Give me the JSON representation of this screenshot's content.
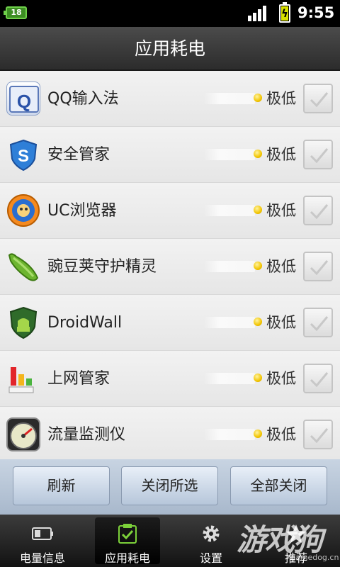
{
  "status_bar": {
    "battery_small": "18",
    "time": "9:55",
    "signal_icon": "signal-bars-icon",
    "charging_icon": "battery-charging-icon"
  },
  "title": "应用耗电",
  "apps": [
    {
      "name": "QQ输入法",
      "usage": "极低",
      "checked": true,
      "icon": "qq-input-icon"
    },
    {
      "name": "安全管家",
      "usage": "极低",
      "checked": true,
      "icon": "security-shield-icon"
    },
    {
      "name": "UC浏览器",
      "usage": "极低",
      "checked": true,
      "icon": "uc-browser-icon"
    },
    {
      "name": "豌豆荚守护精灵",
      "usage": "极低",
      "checked": true,
      "icon": "pea-pod-icon"
    },
    {
      "name": "DroidWall",
      "usage": "极低",
      "checked": true,
      "icon": "droidwall-shield-icon"
    },
    {
      "name": "上网管家",
      "usage": "极低",
      "checked": true,
      "icon": "network-bars-icon"
    },
    {
      "name": "流量监测仪",
      "usage": "极低",
      "checked": true,
      "icon": "speedometer-icon"
    }
  ],
  "buttons": {
    "refresh": "刷新",
    "close_selected": "关闭所选",
    "close_all": "全部关闭"
  },
  "tabs": [
    {
      "label": "电量信息",
      "icon": "battery-icon"
    },
    {
      "label": "应用耗电",
      "icon": "clipboard-check-icon",
      "active": true
    },
    {
      "label": "设置",
      "icon": "gear-icon"
    },
    {
      "label": "推荐",
      "icon": "star-icon"
    }
  ],
  "watermark": {
    "text": "游戏狗",
    "sub": "gamedog.cn"
  },
  "colors": {
    "usage_dot": "#f2c500",
    "title_bg": "#3a3a3a",
    "button_bg": "#c8d4e2"
  }
}
